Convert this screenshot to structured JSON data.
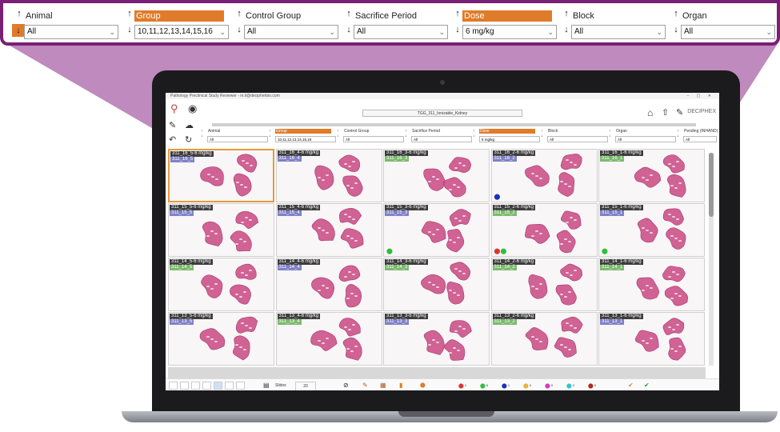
{
  "zoom_filters": [
    {
      "label": "Animal",
      "value": "All",
      "highlight": false,
      "sort_active": true
    },
    {
      "label": "Group",
      "value": "10,11,12,13,14,15,16",
      "highlight": true,
      "sort_active": false
    },
    {
      "label": "Control Group",
      "value": "All",
      "highlight": false,
      "sort_active": false
    },
    {
      "label": "Sacrifice Period",
      "value": "All",
      "highlight": false,
      "sort_active": false
    },
    {
      "label": "Dose",
      "value": "6 mg/kg",
      "highlight": true,
      "sort_active": false
    },
    {
      "label": "Block",
      "value": "All",
      "highlight": false,
      "sort_active": false
    },
    {
      "label": "Organ",
      "value": "All",
      "highlight": false,
      "sort_active": false
    }
  ],
  "app": {
    "window_title": "Pathology Preclinical Study Reviewer - m.li@decipherbio.com",
    "study_name": "TGG_311_Ionizable_Kidney",
    "brand": "DECIPHEX"
  },
  "screen_filters": [
    {
      "label": "Animal",
      "value": "All",
      "highlight": false
    },
    {
      "label": "Group",
      "value": "10,11,12,13,14,15,16",
      "highlight": true
    },
    {
      "label": "Control Group",
      "value": "All",
      "highlight": false
    },
    {
      "label": "Sacrifice Period",
      "value": "All",
      "highlight": false
    },
    {
      "label": "Dose",
      "value": "6 mg/kg",
      "highlight": true
    },
    {
      "label": "Block",
      "value": "All",
      "highlight": false
    },
    {
      "label": "Organ",
      "value": "All",
      "highlight": false
    },
    {
      "label": "Pending (INHAND)",
      "value": "All",
      "highlight": false
    }
  ],
  "slides": [
    {
      "title": "311_16_5-6 mg/kg",
      "id": "311_16_5",
      "tag": "blue",
      "selected": true,
      "pins": []
    },
    {
      "title": "311_16_4-6 mg/kg",
      "id": "311_16_4",
      "tag": "blue",
      "selected": false,
      "pins": []
    },
    {
      "title": "311_16_3-6 mg/kg",
      "id": "311_16_3",
      "tag": "green",
      "selected": false,
      "pins": []
    },
    {
      "title": "311_16_2-6 mg/kg",
      "id": "311_16_2",
      "tag": "blue",
      "selected": false,
      "pins": [
        "#1a2fbf"
      ]
    },
    {
      "title": "311_16_1-6 mg/kg",
      "id": "311_16_1",
      "tag": "green",
      "selected": false,
      "pins": []
    },
    {
      "title": "311_15_5-6 mg/kg",
      "id": "311_15_5",
      "tag": "blue",
      "selected": false,
      "pins": []
    },
    {
      "title": "311_15_4-6 mg/kg",
      "id": "311_15_4",
      "tag": "blue",
      "selected": false,
      "pins": []
    },
    {
      "title": "311_15_3-6 mg/kg",
      "id": "311_15_3",
      "tag": "blue",
      "selected": false,
      "pins": [
        "#2fbf3a"
      ]
    },
    {
      "title": "311_15_2-6 mg/kg",
      "id": "311_15_2",
      "tag": "green",
      "selected": false,
      "pins": [
        "#d33",
        "#2fbf3a"
      ]
    },
    {
      "title": "311_15_1-6 mg/kg",
      "id": "311_15_1",
      "tag": "blue",
      "selected": false,
      "pins": [
        "#2fbf3a"
      ]
    },
    {
      "title": "311_14_5-6 mg/kg",
      "id": "311_14_5",
      "tag": "green",
      "selected": false,
      "pins": []
    },
    {
      "title": "311_14_4-6 mg/kg",
      "id": "311_14_4",
      "tag": "blue",
      "selected": false,
      "pins": []
    },
    {
      "title": "311_14_3-6 mg/kg",
      "id": "311_14_3",
      "tag": "green",
      "selected": false,
      "pins": []
    },
    {
      "title": "311_14_2-6 mg/kg",
      "id": "311_14_2",
      "tag": "green",
      "selected": false,
      "pins": []
    },
    {
      "title": "311_14_1-6 mg/kg",
      "id": "311_14_1",
      "tag": "green",
      "selected": false,
      "pins": []
    },
    {
      "title": "311_13_5-6 mg/kg",
      "id": "311_13_5",
      "tag": "blue",
      "selected": false,
      "pins": []
    },
    {
      "title": "311_13_4-6 mg/kg",
      "id": "311_13_4",
      "tag": "green",
      "selected": false,
      "pins": []
    },
    {
      "title": "311_13_3-6 mg/kg",
      "id": "311_13_3",
      "tag": "blue",
      "selected": false,
      "pins": []
    },
    {
      "title": "311_13_2-6 mg/kg",
      "id": "311_13_2",
      "tag": "green",
      "selected": false,
      "pins": []
    },
    {
      "title": "311_13_1-6 mg/kg",
      "id": "311_13_1",
      "tag": "blue",
      "selected": false,
      "pins": []
    }
  ],
  "statusbar": {
    "slides_label": "Slides",
    "slides_count": "20",
    "pin_counts": [
      {
        "color": "#d33",
        "count": "1"
      },
      {
        "color": "#2fbf3a",
        "count": "6"
      },
      {
        "color": "#1a2fbf",
        "count": "1"
      },
      {
        "color": "#e8b33a",
        "count": "0"
      },
      {
        "color": "#d838c8",
        "count": "0"
      },
      {
        "color": "#2ec9c9",
        "count": "0"
      },
      {
        "color": "#b3261e",
        "count": "0"
      }
    ]
  },
  "colors": {
    "accent_purple": "#7a1f75",
    "highlight_orange": "#e07b2a",
    "tissue_pink": "#c94d86"
  }
}
